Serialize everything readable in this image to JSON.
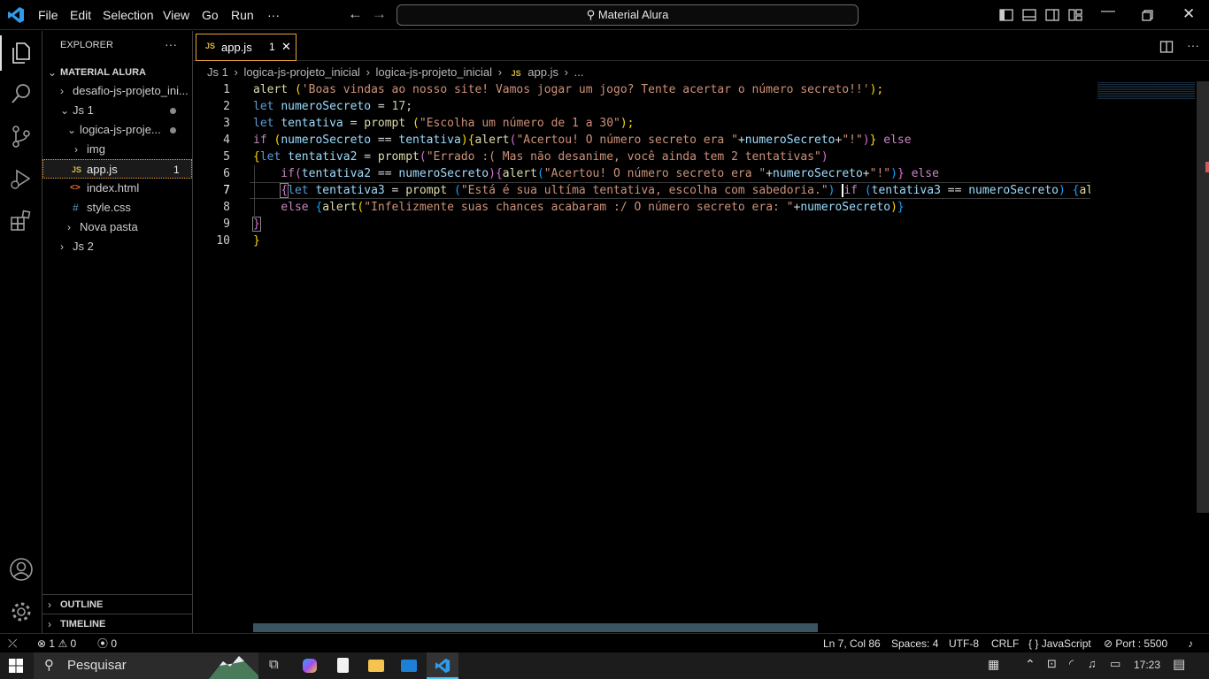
{
  "menu": {
    "file": "File",
    "edit": "Edit",
    "selection": "Selection",
    "view": "View",
    "go": "Go",
    "run": "Run",
    "more": "···"
  },
  "search": {
    "label": "Material Alura"
  },
  "sidebar": {
    "title": "EXPLORER",
    "more": "···",
    "section": "MATERIAL ALURA",
    "items": [
      {
        "label": "desafio-js-projeto_ini..."
      },
      {
        "label": "Js 1"
      },
      {
        "label": "logica-js-proje..."
      },
      {
        "label": "img"
      },
      {
        "label": "app.js",
        "badge": "1",
        "icon": "JS"
      },
      {
        "label": "index.html",
        "icon": "<>"
      },
      {
        "label": "style.css",
        "icon": "#"
      },
      {
        "label": "Nova pasta"
      },
      {
        "label": "Js 2"
      }
    ],
    "outline": "OUTLINE",
    "timeline": "TIMELINE"
  },
  "tab": {
    "icon": "JS",
    "label": "app.js",
    "badge": "1",
    "close": "✕"
  },
  "breadcrumb": {
    "p1": "Js 1",
    "p2": "logica-js-projeto_inicial",
    "p3": "logica-js-projeto_inicial",
    "icon": "JS",
    "p4": "app.js",
    "p5": "..."
  },
  "code": {
    "l1a": "alert ",
    "l1b": "(",
    "l1c": "'Boas vindas ao nosso site! Vamos jogar um jogo? Tente acertar o número secreto!!'",
    "l1d": ");",
    "l2a": "let ",
    "l2b": "numeroSecreto",
    "l2c": " = ",
    "l2d": "17",
    "l2e": ";",
    "l3a": "let ",
    "l3b": "tentativa",
    "l3c": " = ",
    "l3d": "prompt",
    "l3e": " (",
    "l3f": "\"Escolha um número de 1 a 30\"",
    "l3g": ");",
    "l4a": "if ",
    "l4b": "(",
    "l4c": "numeroSecreto",
    "l4d": " == ",
    "l4e": "tentativa",
    "l4f": ")",
    "l4g": "{",
    "l4h": "alert",
    "l4i": "(",
    "l4j": "\"Acertou! O número secreto era \"",
    "l4k": "+",
    "l4l": "numeroSecreto",
    "l4m": "+",
    "l4n": "\"!\"",
    "l4o": ")",
    "l4p": "}",
    "l4q": " else",
    "l5a": "{",
    "l5b": "let ",
    "l5c": "tentativa2",
    "l5d": " = ",
    "l5e": "prompt",
    "l5f": "(",
    "l5g": "\"Errado :( Mas não desanime, você ainda tem 2 tentativas\"",
    "l5h": ")",
    "l6a": "    if",
    "l6b": "(",
    "l6c": "tentativa2",
    "l6d": " == ",
    "l6e": "numeroSecreto",
    "l6f": ")",
    "l6g": "{",
    "l6h": "alert",
    "l6i": "(",
    "l6j": "\"Acertou! O número secreto era \"",
    "l6k": "+",
    "l6l": "numeroSecreto",
    "l6m": "+",
    "l6n": "\"!\"",
    "l6o": ")",
    "l6p": "}",
    "l6q": " else",
    "l7a": "    ",
    "l7b": "{",
    "l7c": "let ",
    "l7d": "tentativa3",
    "l7e": " = ",
    "l7f": "prompt",
    "l7g": " (",
    "l7h": "\"Está é sua ultíma tentativa, escolha com sabedoria.\"",
    "l7i": ") ",
    "l7j": "if ",
    "l7k": "(",
    "l7l": "tentativa3",
    "l7m": " == ",
    "l7n": "numeroSecreto",
    "l7o": ") ",
    "l7p": "{",
    "l7q": "aler",
    "l8a": "    else ",
    "l8b": "{",
    "l8c": "alert",
    "l8d": "(",
    "l8e": "\"Infelizmente suas chances acabaram :/ O número secreto era: \"",
    "l8f": "+",
    "l8g": "numeroSecreto",
    "l8h": ")",
    "l8i": "}",
    "l9a": "}",
    "l10a": "}"
  },
  "line_numbers": [
    "1",
    "2",
    "3",
    "4",
    "5",
    "6",
    "7",
    "8",
    "9",
    "10"
  ],
  "status": {
    "errors": "1",
    "warnings": "0",
    "ports": "0",
    "position": "Ln 7, Col 86",
    "spaces": "Spaces: 4",
    "encoding": "UTF-8",
    "eol": "CRLF",
    "language": "JavaScript",
    "port": "Port : 5500",
    "lang_icon": "{ }"
  },
  "taskbar": {
    "search": "Pesquisar",
    "time": "17:23"
  },
  "colors": {
    "accent": "#007acc",
    "tab_border": "#e8a23a"
  }
}
